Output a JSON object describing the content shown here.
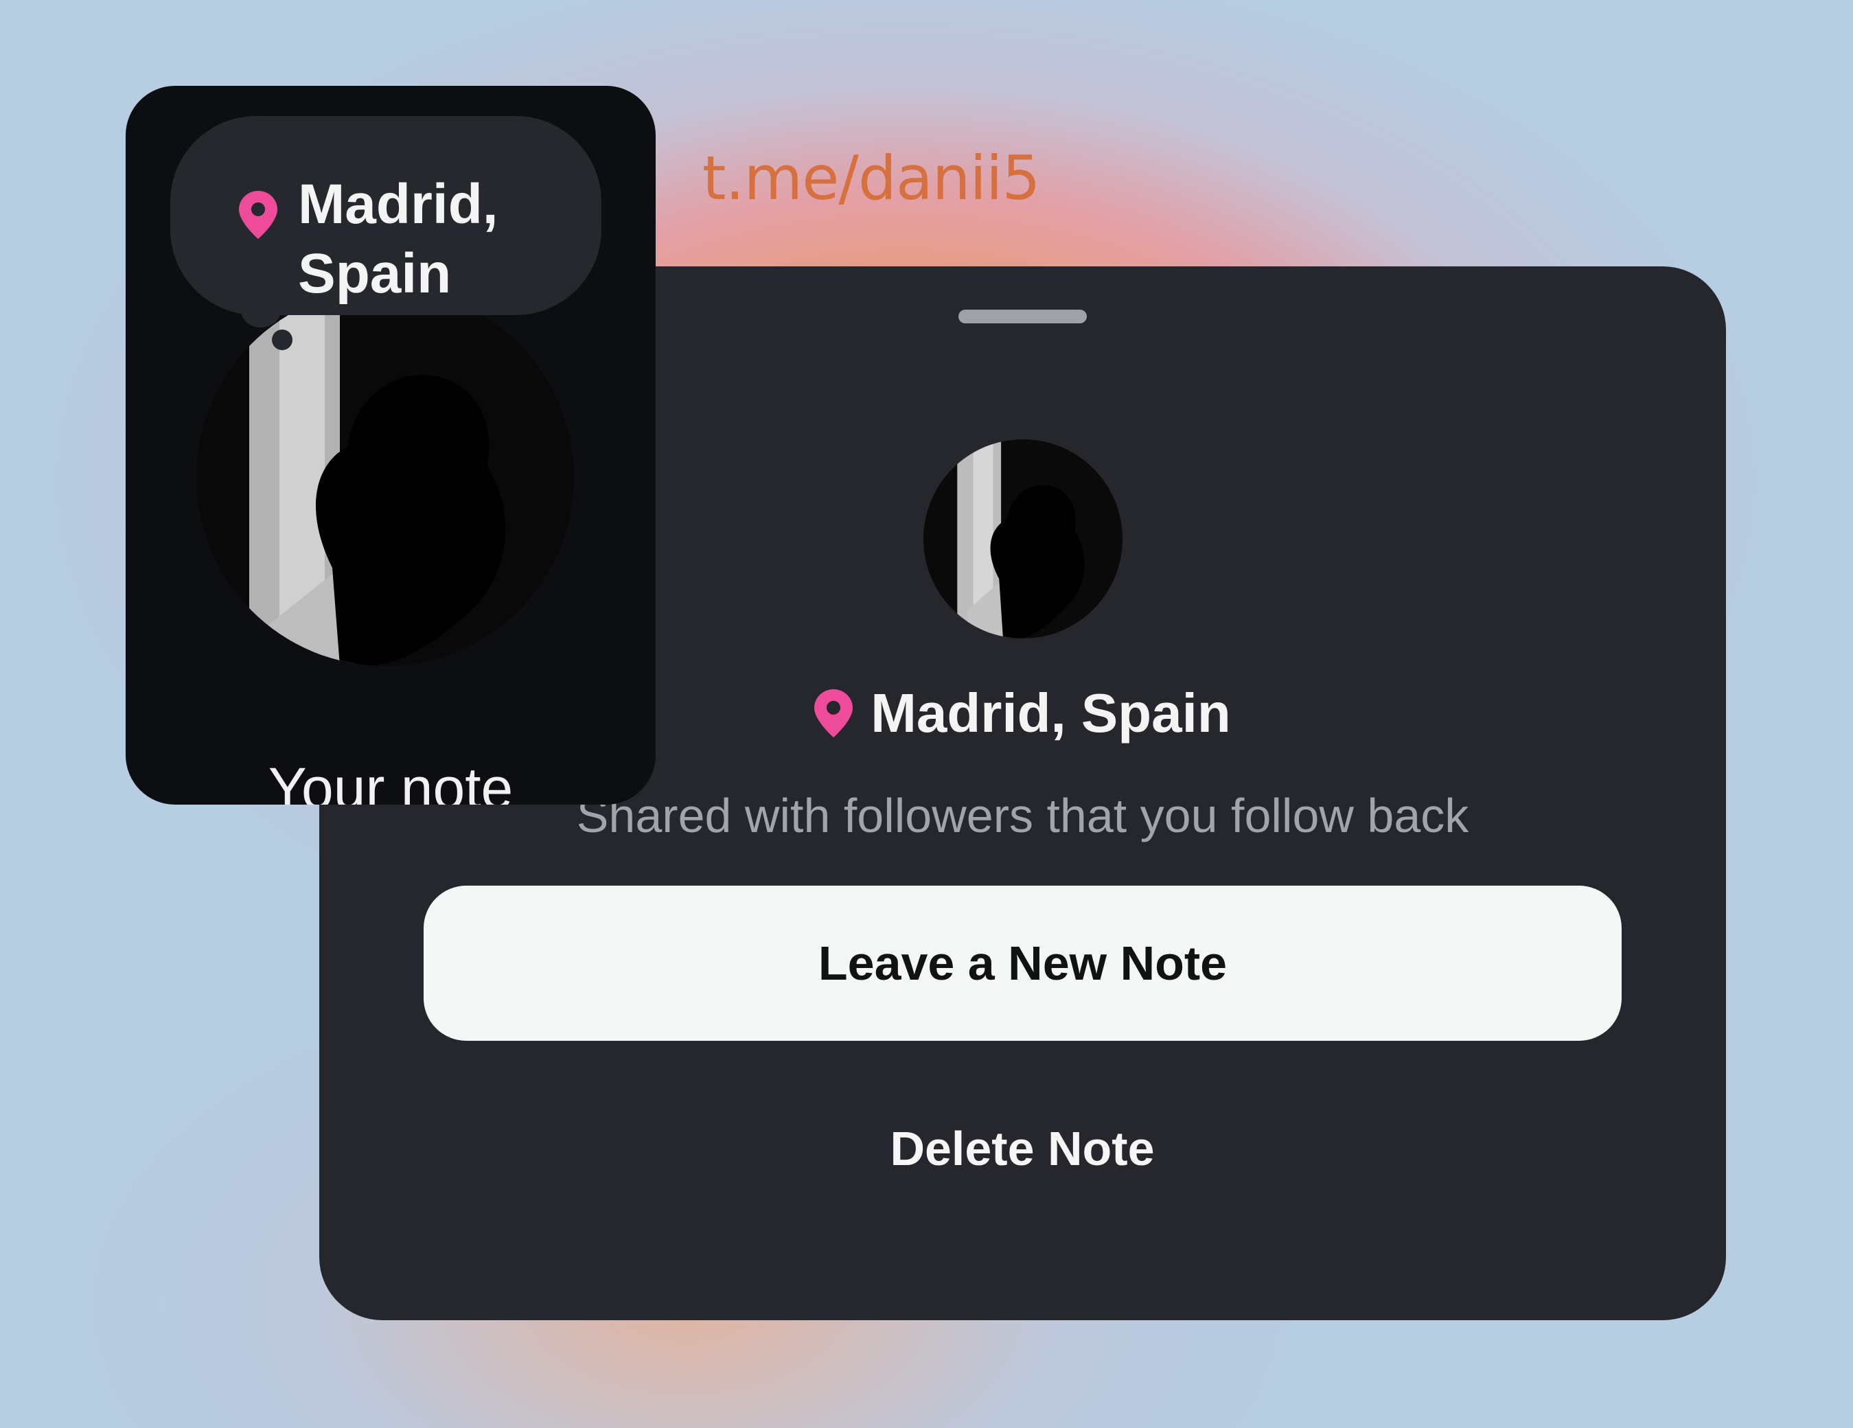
{
  "watermark": "t.me/danii5",
  "sheet": {
    "location": "Madrid, Spain",
    "subtitle": "Shared with followers that you follow back",
    "primary_button": "Leave a New Note",
    "delete_button": "Delete Note"
  },
  "note_card": {
    "bubble_line1": "Madrid,",
    "bubble_line2": "Spain",
    "label": "Your note"
  },
  "colors": {
    "pin": "#ee4c9a",
    "sheet_bg": "#25272c",
    "card_bg": "#0c0e12",
    "button_bg": "#f5f7f6",
    "watermark": "#d7703f"
  },
  "icons": {
    "location_pin": "location-pin-icon",
    "avatar": "profile-avatar"
  }
}
